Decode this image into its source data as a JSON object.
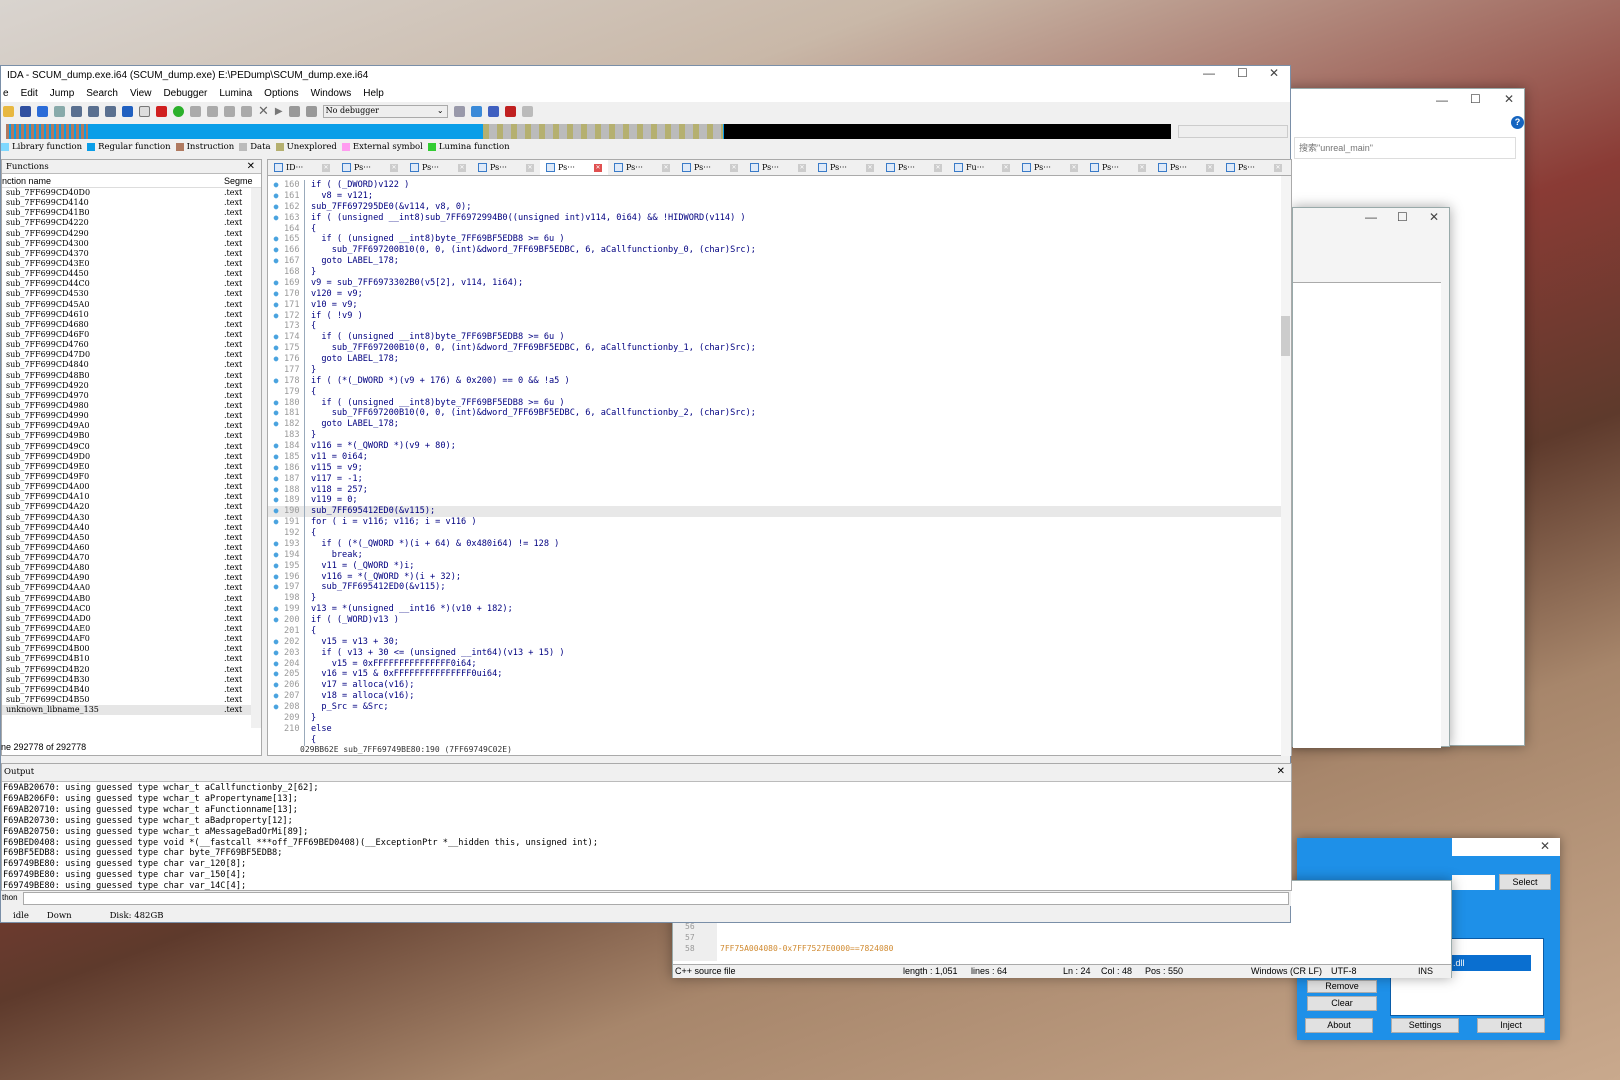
{
  "ida": {
    "title": "IDA - SCUM_dump.exe.i64 (SCUM_dump.exe) E:\\PEDump\\SCUM_dump.exe.i64",
    "menu": [
      "e",
      "Edit",
      "Jump",
      "Search",
      "View",
      "Debugger",
      "Lumina",
      "Options",
      "Windows",
      "Help"
    ],
    "debugger_select": "No debugger",
    "legend": [
      {
        "label": "Library function",
        "color": "#7fd8ff"
      },
      {
        "label": "Regular function",
        "color": "#0a9ee8"
      },
      {
        "label": "Instruction",
        "color": "#b07a60"
      },
      {
        "label": "Data",
        "color": "#bbbbbb"
      },
      {
        "label": "Unexplored",
        "color": "#b5b070"
      },
      {
        "label": "External symbol",
        "color": "#ff9cf0"
      },
      {
        "label": "Lumina function",
        "color": "#33cc33"
      }
    ],
    "functions": {
      "title": "Functions",
      "col_name": "nction name",
      "col_seg": "Segme",
      "segment": ".text",
      "items": [
        "sub_7FF699CD40D0",
        "sub_7FF699CD4140",
        "sub_7FF699CD41B0",
        "sub_7FF699CD4220",
        "sub_7FF699CD4290",
        "sub_7FF699CD4300",
        "sub_7FF699CD4370",
        "sub_7FF699CD43E0",
        "sub_7FF699CD4450",
        "sub_7FF699CD44C0",
        "sub_7FF699CD4530",
        "sub_7FF699CD45A0",
        "sub_7FF699CD4610",
        "sub_7FF699CD4680",
        "sub_7FF699CD46F0",
        "sub_7FF699CD4760",
        "sub_7FF699CD47D0",
        "sub_7FF699CD4840",
        "sub_7FF699CD48B0",
        "sub_7FF699CD4920",
        "sub_7FF699CD4970",
        "sub_7FF699CD4980",
        "sub_7FF699CD4990",
        "sub_7FF699CD49A0",
        "sub_7FF699CD49B0",
        "sub_7FF699CD49C0",
        "sub_7FF699CD49D0",
        "sub_7FF699CD49E0",
        "sub_7FF699CD49F0",
        "sub_7FF699CD4A00",
        "sub_7FF699CD4A10",
        "sub_7FF699CD4A20",
        "sub_7FF699CD4A30",
        "sub_7FF699CD4A40",
        "sub_7FF699CD4A50",
        "sub_7FF699CD4A60",
        "sub_7FF699CD4A70",
        "sub_7FF699CD4A80",
        "sub_7FF699CD4A90",
        "sub_7FF699CD4AA0",
        "sub_7FF699CD4AB0",
        "sub_7FF699CD4AC0",
        "sub_7FF699CD4AD0",
        "sub_7FF699CD4AE0",
        "sub_7FF699CD4AF0",
        "sub_7FF699CD4B00",
        "sub_7FF699CD4B10",
        "sub_7FF699CD4B20",
        "sub_7FF699CD4B30",
        "sub_7FF699CD4B40",
        "sub_7FF699CD4B50",
        "unknown_libname_135"
      ],
      "footer": "ne 292778 of 292778"
    },
    "tabs": [
      "ID···",
      "Ps···",
      "Ps···",
      "Ps···",
      "Ps···",
      "Ps···",
      "Ps···",
      "Ps···",
      "Ps···",
      "Ps···",
      "Fu···",
      "Ps···",
      "Ps···",
      "Ps···",
      "Ps···"
    ],
    "active_tab": 4,
    "code": [
      {
        "n": "160",
        "d": true,
        "t": "if ( (_DWORD)v122 )"
      },
      {
        "n": "161",
        "d": true,
        "t": "  v8 = v121;"
      },
      {
        "n": "162",
        "d": true,
        "t": "sub_7FF697295DE0(&v114, v8, 0);"
      },
      {
        "n": "163",
        "d": true,
        "t": "if ( (unsigned __int8)sub_7FF6972994B0((unsigned int)v114, 0i64) && !HIDWORD(v114) )"
      },
      {
        "n": "164",
        "d": false,
        "t": "{"
      },
      {
        "n": "165",
        "d": true,
        "t": "  if ( (unsigned __int8)byte_7FF69BF5EDB8 >= 6u )"
      },
      {
        "n": "166",
        "d": true,
        "t": "    sub_7FF697200B10(0, 0, (int)&dword_7FF69BF5EDBC, 6, aCallfunctionby_0, (char)Src);"
      },
      {
        "n": "167",
        "d": true,
        "t": "  goto LABEL_178;"
      },
      {
        "n": "168",
        "d": false,
        "t": "}"
      },
      {
        "n": "169",
        "d": true,
        "t": "v9 = sub_7FF6973302B0(v5[2], v114, 1i64);"
      },
      {
        "n": "170",
        "d": true,
        "t": "v120 = v9;"
      },
      {
        "n": "171",
        "d": true,
        "t": "v10 = v9;"
      },
      {
        "n": "172",
        "d": true,
        "t": "if ( !v9 )"
      },
      {
        "n": "173",
        "d": false,
        "t": "{"
      },
      {
        "n": "174",
        "d": true,
        "t": "  if ( (unsigned __int8)byte_7FF69BF5EDB8 >= 6u )"
      },
      {
        "n": "175",
        "d": true,
        "t": "    sub_7FF697200B10(0, 0, (int)&dword_7FF69BF5EDBC, 6, aCallfunctionby_1, (char)Src);"
      },
      {
        "n": "176",
        "d": true,
        "t": "  goto LABEL_178;"
      },
      {
        "n": "177",
        "d": false,
        "t": "}"
      },
      {
        "n": "178",
        "d": true,
        "t": "if ( (*(_DWORD *)(v9 + 176) & 0x200) == 0 && !a5 )"
      },
      {
        "n": "179",
        "d": false,
        "t": "{"
      },
      {
        "n": "180",
        "d": true,
        "t": "  if ( (unsigned __int8)byte_7FF69BF5EDB8 >= 6u )"
      },
      {
        "n": "181",
        "d": true,
        "t": "    sub_7FF697200B10(0, 0, (int)&dword_7FF69BF5EDBC, 6, aCallfunctionby_2, (char)Src);"
      },
      {
        "n": "182",
        "d": true,
        "t": "  goto LABEL_178;"
      },
      {
        "n": "183",
        "d": false,
        "t": "}"
      },
      {
        "n": "184",
        "d": true,
        "t": "v116 = *(_QWORD *)(v9 + 80);"
      },
      {
        "n": "185",
        "d": true,
        "t": "v11 = 0i64;"
      },
      {
        "n": "186",
        "d": true,
        "t": "v115 = v9;"
      },
      {
        "n": "187",
        "d": true,
        "t": "v117 = -1;"
      },
      {
        "n": "188",
        "d": true,
        "t": "v118 = 257;"
      },
      {
        "n": "189",
        "d": true,
        "t": "v119 = 0;"
      },
      {
        "n": "190",
        "d": true,
        "t": "sub_7FF695412ED0(&v115);"
      },
      {
        "n": "191",
        "d": true,
        "t": "for ( i = v116; v116; i = v116 )"
      },
      {
        "n": "192",
        "d": false,
        "t": "{"
      },
      {
        "n": "193",
        "d": true,
        "t": "  if ( (*(_QWORD *)(i + 64) & 0x480i64) != 128 )"
      },
      {
        "n": "194",
        "d": true,
        "t": "    break;"
      },
      {
        "n": "195",
        "d": true,
        "t": "  v11 = (_QWORD *)i;"
      },
      {
        "n": "196",
        "d": true,
        "t": "  v116 = *(_QWORD *)(i + 32);"
      },
      {
        "n": "197",
        "d": true,
        "t": "  sub_7FF695412ED0(&v115);"
      },
      {
        "n": "198",
        "d": false,
        "t": "}"
      },
      {
        "n": "199",
        "d": true,
        "t": "v13 = *(unsigned __int16 *)(v10 + 182);"
      },
      {
        "n": "200",
        "d": true,
        "t": "if ( (_WORD)v13 )"
      },
      {
        "n": "201",
        "d": false,
        "t": "{"
      },
      {
        "n": "202",
        "d": true,
        "t": "  v15 = v13 + 30;"
      },
      {
        "n": "203",
        "d": true,
        "t": "  if ( v13 + 30 <= (unsigned __int64)(v13 + 15) )"
      },
      {
        "n": "204",
        "d": true,
        "t": "    v15 = 0xFFFFFFFFFFFFFFF0i64;"
      },
      {
        "n": "205",
        "d": true,
        "t": "  v16 = v15 & 0xFFFFFFFFFFFFFFF0ui64;"
      },
      {
        "n": "206",
        "d": true,
        "t": "  v17 = alloca(v16);"
      },
      {
        "n": "207",
        "d": true,
        "t": "  v18 = alloca(v16);"
      },
      {
        "n": "208",
        "d": true,
        "t": "  p_Src = &Src;"
      },
      {
        "n": "209",
        "d": false,
        "t": "}"
      },
      {
        "n": "210",
        "d": false,
        "t": "else"
      },
      {
        "n": "",
        "d": false,
        "t": "{"
      }
    ],
    "highlight_line": "190",
    "code_status": "029BB62E sub_7FF69749BE80:190 (7FF69749C02E)",
    "output": {
      "title": "Output",
      "lines": [
        "F69AB20670: using guessed type wchar_t aCallfunctionby_2[62];",
        "F69AB206F0: using guessed type wchar_t aPropertyname[13];",
        "F69AB20710: using guessed type wchar_t aFunctionname[13];",
        "F69AB20730: using guessed type wchar_t aBadproperty[12];",
        "F69AB20750: using guessed type wchar_t aMessageBadOrMi[89];",
        "F69BED0408: using guessed type void *(__fastcall ***off_7FF69BED0408)(__ExceptionPtr *__hidden this, unsigned int);",
        "F69BF5EDB8: using guessed type char byte_7FF69BF5EDB8;",
        "F69749BE80: using guessed type char var_120[8];",
        "F69749BE80: using guessed type char var_150[4];",
        "F69749BE80: using guessed type char var_14C[4];"
      ],
      "cmd_label": "thon",
      "cmd_value": ""
    },
    "status": [
      "idle",
      "Down",
      "Disk: 482GB"
    ]
  },
  "search_window": {
    "search_placeholder": "搜索\"unreal_main\""
  },
  "editor": {
    "line_numbers": [
      "56",
      "57",
      "58"
    ],
    "line58": "7FF75A004080-0x7FF7527E0000==7824080",
    "status": [
      "C++ source file",
      "length : 1,051",
      "lines : 64",
      "Ln : 24",
      "Col : 48",
      "Pos : 550",
      "Windows (CR LF)",
      "UTF-8",
      "INS"
    ]
  },
  "injector": {
    "select": "Select",
    "list_item": ".dll",
    "clear": "Clear",
    "about": "About",
    "settings": "Settings",
    "inject": "Inject",
    "remove": "Remove"
  }
}
